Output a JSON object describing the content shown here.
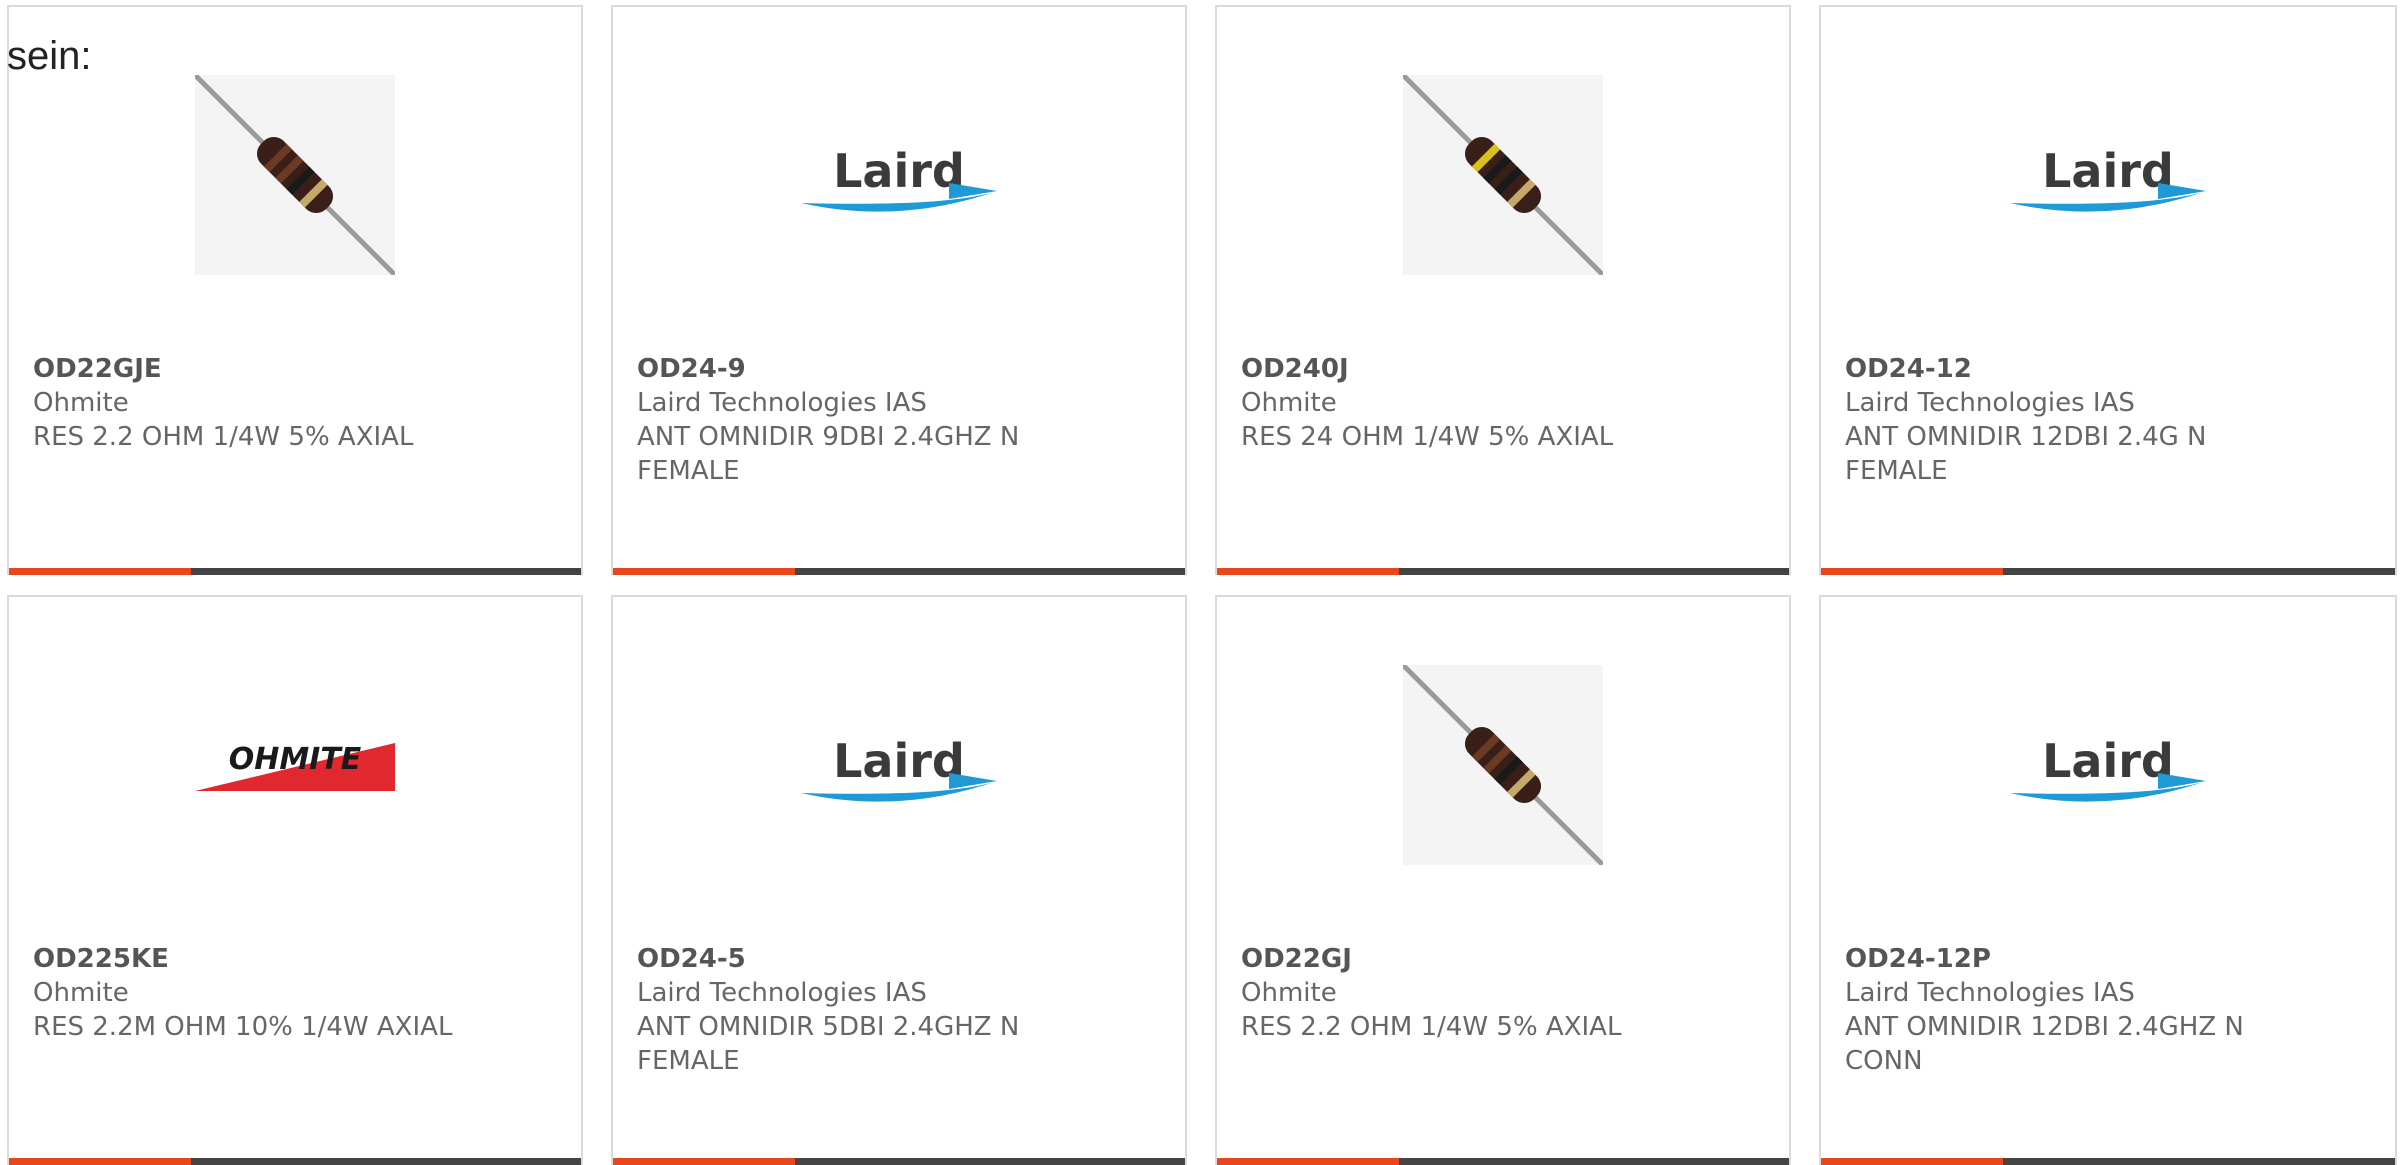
{
  "intro_text": "sein:",
  "colors": {
    "accent": "#e8461c",
    "bar": "#444444",
    "border": "#dadada",
    "text": "#666666"
  },
  "products": [
    {
      "part": "OD22GJE",
      "manufacturer": "Ohmite",
      "description": "RES 2.2 OHM 1/4W 5% AXIAL",
      "image": "resistor-brown-bands"
    },
    {
      "part": "OD24-9",
      "manufacturer": "Laird Technologies IAS",
      "description": "ANT OMNIDIR 9DBI 2.4GHZ N FEMALE",
      "image": "laird-logo",
      "logo_text": "Laird"
    },
    {
      "part": "OD240J",
      "manufacturer": "Ohmite",
      "description": "RES 24 OHM 1/4W 5% AXIAL",
      "image": "resistor-yellow-band"
    },
    {
      "part": "OD24-12",
      "manufacturer": "Laird Technologies IAS",
      "description": "ANT OMNIDIR 12DBI 2.4G N FEMALE",
      "image": "laird-logo",
      "logo_text": "Laird"
    },
    {
      "part": "OD225KE",
      "manufacturer": "Ohmite",
      "description": "RES 2.2M OHM 10% 1/4W AXIAL",
      "image": "ohmite-logo",
      "logo_text": "OHMITE"
    },
    {
      "part": "OD24-5",
      "manufacturer": "Laird Technologies IAS",
      "description": "ANT OMNIDIR 5DBI 2.4GHZ N FEMALE",
      "image": "laird-logo",
      "logo_text": "Laird"
    },
    {
      "part": "OD22GJ",
      "manufacturer": "Ohmite",
      "description": "RES 2.2 OHM 1/4W 5% AXIAL",
      "image": "resistor-brown-bands"
    },
    {
      "part": "OD24-12P",
      "manufacturer": "Laird Technologies IAS",
      "description": "ANT OMNIDIR 12DBI 2.4GHZ N CONN",
      "image": "laird-logo",
      "logo_text": "Laird"
    }
  ]
}
